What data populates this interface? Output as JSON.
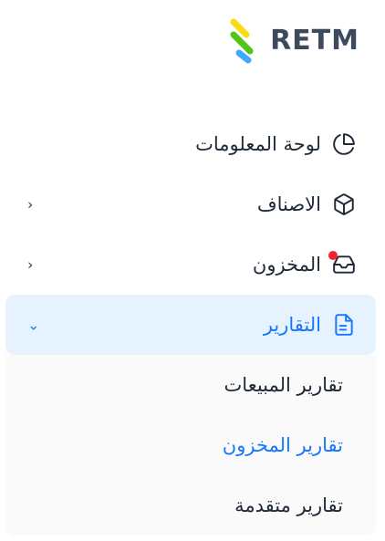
{
  "brand": {
    "name": "RETM",
    "colors": {
      "green": "#52c41a",
      "yellow": "#fadb14",
      "blue": "#40a9ff"
    }
  },
  "menu": {
    "items": [
      {
        "label": "لوحة المعلومات",
        "icon": "pie-chart-icon",
        "has_submenu": false
      },
      {
        "label": "الاصناف",
        "icon": "box-icon",
        "has_submenu": true,
        "chevron": "‹"
      },
      {
        "label": "المخزون",
        "icon": "inbox-icon",
        "has_submenu": true,
        "chevron": "‹",
        "notification": true
      },
      {
        "label": "التقارير",
        "icon": "file-text-icon",
        "has_submenu": true,
        "chevron": "⌄",
        "expanded": true,
        "active": true
      }
    ],
    "reports_submenu": [
      {
        "label": "تقارير المبيعات",
        "selected": false
      },
      {
        "label": "تقارير المخزون",
        "selected": true
      },
      {
        "label": "تقارير متقدمة",
        "selected": false
      }
    ]
  },
  "colors": {
    "accent": "#1677ff",
    "active_bg": "#e6f2fd",
    "notification": "#f5222d"
  }
}
